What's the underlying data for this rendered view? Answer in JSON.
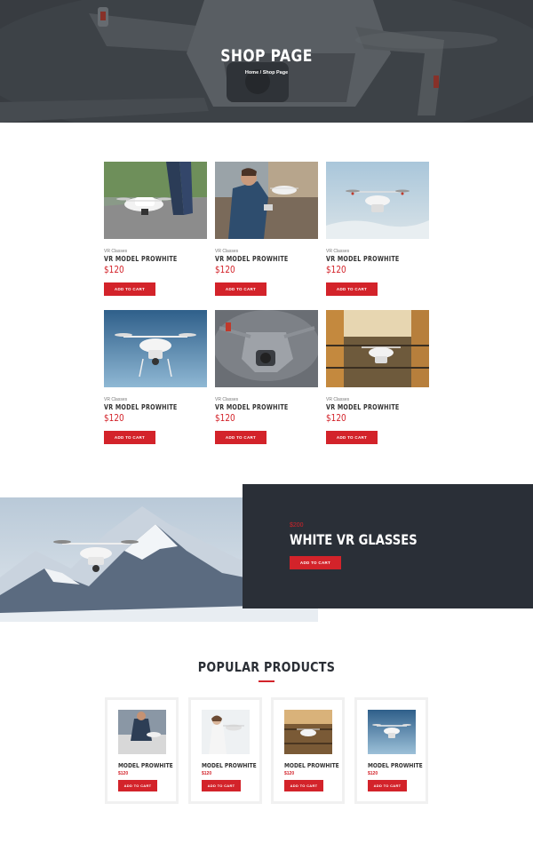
{
  "hero": {
    "title": "SHOP PAGE",
    "breadcrumb": "Home / Shop Page"
  },
  "products": [
    {
      "category": "VR Classes",
      "name": "VR MODEL PROWHITE",
      "price": "$120",
      "button": "ADD TO CART",
      "image": "drone-on-road"
    },
    {
      "category": "VR Classes",
      "name": "VR MODEL PROWHITE",
      "price": "$120",
      "button": "ADD TO CART",
      "image": "man-with-drone"
    },
    {
      "category": "VR Classes",
      "name": "VR MODEL PROWHITE",
      "price": "$120",
      "button": "ADD TO CART",
      "image": "drone-in-sky"
    },
    {
      "category": "VR Classes",
      "name": "VR MODEL PROWHITE",
      "price": "$120",
      "button": "ADD TO CART",
      "image": "drone-blue-sky"
    },
    {
      "category": "VR Classes",
      "name": "VR MODEL PROWHITE",
      "price": "$120",
      "button": "ADD TO CART",
      "image": "grey-drone-closeup"
    },
    {
      "category": "VR Classes",
      "name": "VR MODEL PROWHITE",
      "price": "$120",
      "button": "ADD TO CART",
      "image": "drone-in-warehouse"
    }
  ],
  "feature": {
    "price": "$200",
    "title": "WHITE VR GLASSES",
    "button": "ADD TO CART",
    "image": "drone-over-mountains"
  },
  "popular": {
    "title": "POPULAR PRODUCTS",
    "items": [
      {
        "name": "MODEL PROWHITE",
        "price": "$120",
        "button": "ADD TO CART",
        "image": "person-with-drone"
      },
      {
        "name": "MODEL PROWHITE",
        "price": "$120",
        "button": "ADD TO CART",
        "image": "woman-with-drone"
      },
      {
        "name": "MODEL PROWHITE",
        "price": "$120",
        "button": "ADD TO CART",
        "image": "drone-warehouse"
      },
      {
        "name": "MODEL PROWHITE",
        "price": "$120",
        "button": "ADD TO CART",
        "image": "drone-sky"
      }
    ]
  },
  "colors": {
    "accent": "#d3232a",
    "dark_panel": "#2a2f37",
    "heading": "#2b2f36"
  }
}
